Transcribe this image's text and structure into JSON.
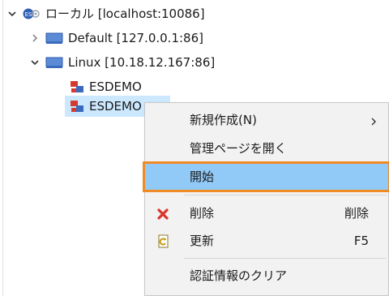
{
  "tree": {
    "root": {
      "label": "ローカル [localhost:10086]",
      "expanded": true
    },
    "default_node": {
      "label": "Default [127.0.0.1:86]",
      "expanded": false
    },
    "linux_node": {
      "label": "Linux [10.18.12.167:86]",
      "expanded": true
    },
    "instances": [
      {
        "label": "ESDEMO"
      },
      {
        "label": "ESDEMO",
        "selected": true
      }
    ]
  },
  "context_menu": {
    "new_item": {
      "label": "新規作成(N)"
    },
    "open_admin": {
      "label": "管理ページを開く"
    },
    "start": {
      "label": "開始",
      "highlighted": true
    },
    "delete": {
      "label": "削除",
      "shortcut": "削除"
    },
    "refresh": {
      "label": "更新",
      "shortcut": "F5"
    },
    "clear_credentials": {
      "label": "認証情報のクリア"
    }
  },
  "colors": {
    "selection": "#cce8ff",
    "menu_background": "#f2f2f2",
    "menu_highlight": "#91c9f7",
    "highlight_border": "#f08a24",
    "delete_icon": "#d9342b"
  }
}
